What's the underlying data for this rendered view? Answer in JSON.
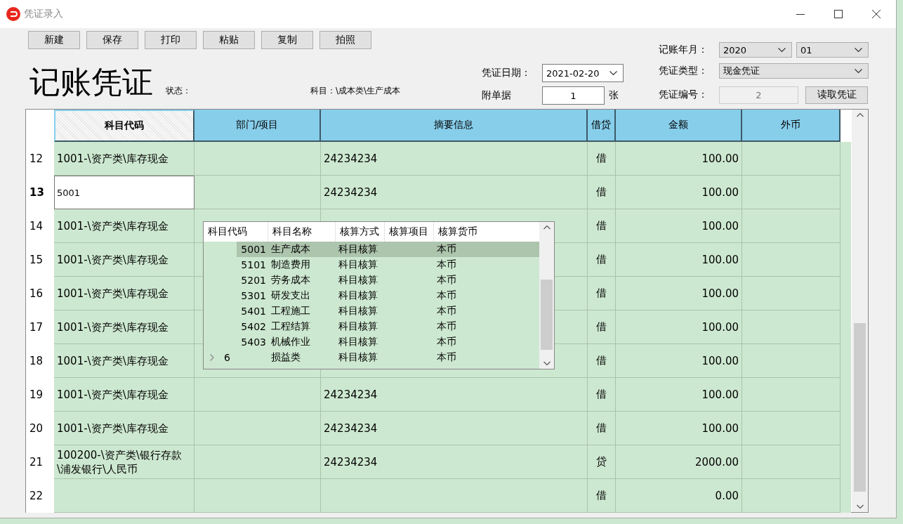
{
  "window": {
    "title": "凭证录入"
  },
  "toolbar": [
    "新建",
    "保存",
    "打印",
    "粘贴",
    "复制",
    "拍照"
  ],
  "heading": "记账凭证",
  "status_label": "状态：",
  "subject_path": "科目：\\成本类\\生产成本",
  "period": {
    "label": "记账年月：",
    "year": "2020",
    "month": "01"
  },
  "voucher_date": {
    "label": "凭证日期：",
    "value": "2021-02-20"
  },
  "voucher_type": {
    "label": "凭证类型：",
    "value": "现金凭证"
  },
  "attachments": {
    "label": "附单据",
    "value": "1",
    "unit": "张"
  },
  "voucher_number": {
    "label": "凭证编号：",
    "value": "2",
    "disabled": true
  },
  "read_button": "读取凭证",
  "table": {
    "columns": [
      {
        "label": "科目代码",
        "selected": true
      },
      {
        "label": "部门/项目",
        "selected": false
      },
      {
        "label": "摘要信息",
        "selected": false
      },
      {
        "label": "借贷",
        "selected": false
      },
      {
        "label": "金额",
        "selected": false
      },
      {
        "label": "外币",
        "selected": false
      }
    ],
    "rows": [
      {
        "number": "12",
        "editing": false,
        "account": "1001-\\资产类\\库存现金",
        "summary": "24234234",
        "direction": "借",
        "amount": "100.00"
      },
      {
        "number": "13",
        "editing": true,
        "account": "5001",
        "summary": "24234234",
        "direction": "借",
        "amount": "100.00"
      },
      {
        "number": "14",
        "editing": false,
        "account": "1001-\\资产类\\库存现金",
        "direction": "借",
        "amount": "100.00"
      },
      {
        "number": "15",
        "editing": false,
        "account": "1001-\\资产类\\库存现金",
        "direction": "借",
        "amount": "100.00"
      },
      {
        "number": "16",
        "editing": false,
        "account": "1001-\\资产类\\库存现金",
        "direction": "借",
        "amount": "100.00"
      },
      {
        "number": "17",
        "editing": false,
        "account": "1001-\\资产类\\库存现金",
        "direction": "借",
        "amount": "100.00"
      },
      {
        "number": "18",
        "editing": false,
        "account": "1001-\\资产类\\库存现金",
        "direction": "借",
        "amount": "100.00"
      },
      {
        "number": "19",
        "editing": false,
        "account": "1001-\\资产类\\库存现金",
        "summary": "24234234",
        "direction": "借",
        "amount": "100.00"
      },
      {
        "number": "20",
        "editing": false,
        "account": "1001-\\资产类\\库存现金",
        "summary": "24234234",
        "direction": "借",
        "amount": "100.00"
      },
      {
        "number": "21",
        "editing": false,
        "account": "100200-\\资产类\\银行存款\n\\浦发银行\\人民币",
        "summary": "24234234",
        "direction": "贷",
        "amount": "2000.00"
      },
      {
        "number": "22",
        "editing": false,
        "direction": "借",
        "amount": "0.00"
      }
    ]
  },
  "lookup": {
    "columns": [
      "科目代码",
      "科目名称",
      "核算方式",
      "核算项目",
      "核算货币"
    ],
    "rows": [
      {
        "kind": "leaf",
        "selected": true,
        "code": "5001",
        "name": "生产成本",
        "method": "科目核算",
        "currency": "本币"
      },
      {
        "kind": "leaf",
        "selected": false,
        "code": "5101",
        "name": "制造费用",
        "method": "科目核算",
        "currency": "本币"
      },
      {
        "kind": "leaf",
        "selected": false,
        "code": "5201",
        "name": "劳务成本",
        "method": "科目核算",
        "currency": "本币"
      },
      {
        "kind": "leaf",
        "selected": false,
        "code": "5301",
        "name": "研发支出",
        "method": "科目核算",
        "currency": "本币"
      },
      {
        "kind": "leaf",
        "selected": false,
        "code": "5401",
        "name": "工程施工",
        "method": "科目核算",
        "currency": "本币"
      },
      {
        "kind": "leaf",
        "selected": false,
        "code": "5402",
        "name": "工程结算",
        "method": "科目核算",
        "currency": "本币"
      },
      {
        "kind": "leaf",
        "selected": false,
        "code": "5403",
        "name": "机械作业",
        "method": "科目核算",
        "currency": "本币"
      },
      {
        "kind": "group",
        "selected": false,
        "code": "6",
        "name": "损益类",
        "method": "科目核算",
        "currency": "本币"
      }
    ]
  }
}
